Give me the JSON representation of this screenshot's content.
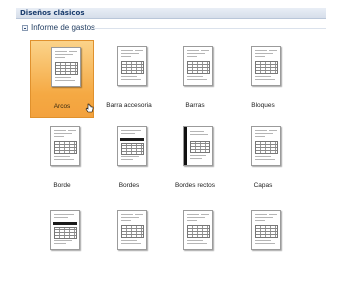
{
  "header": {
    "title": "Diseños clásicos"
  },
  "group": {
    "label": "Informe de gastos",
    "expanded": true
  },
  "tiles": [
    {
      "label": "Arcos",
      "selected": true,
      "style": "plain"
    },
    {
      "label": "Barra accesoria",
      "selected": false,
      "style": "plain"
    },
    {
      "label": "Barras",
      "selected": false,
      "style": "plain"
    },
    {
      "label": "Bloques",
      "selected": false,
      "style": "plain"
    },
    {
      "label": "Borde",
      "selected": false,
      "style": "plain"
    },
    {
      "label": "Bordes",
      "selected": false,
      "style": "dark-band"
    },
    {
      "label": "Bordes rectos",
      "selected": false,
      "style": "left-bar"
    },
    {
      "label": "Capas",
      "selected": false,
      "style": "plain"
    },
    {
      "label": "",
      "selected": false,
      "style": "dark-band"
    },
    {
      "label": "",
      "selected": false,
      "style": "plain"
    },
    {
      "label": "",
      "selected": false,
      "style": "plain"
    },
    {
      "label": "",
      "selected": false,
      "style": "plain"
    }
  ],
  "colors": {
    "selection": "#f5a943",
    "header_text": "#1c3e6e"
  }
}
